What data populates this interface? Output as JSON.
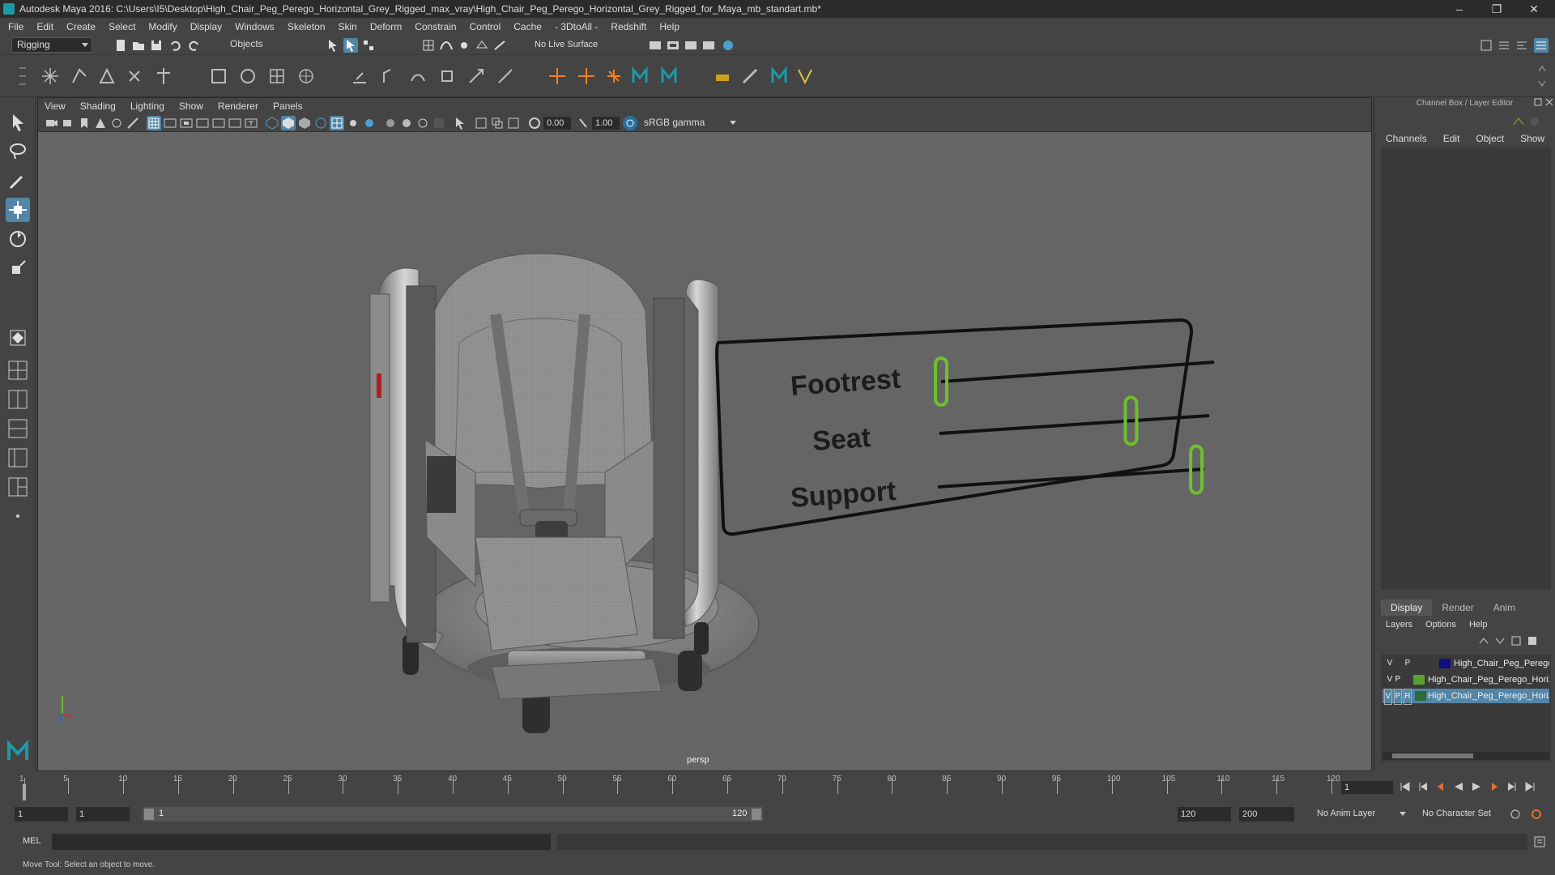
{
  "window": {
    "title": "Autodesk Maya 2016: C:\\Users\\I5\\Desktop\\High_Chair_Peg_Perego_Horizontal_Grey_Rigged_max_vray\\High_Chair_Peg_Perego_Horizontal_Grey_Rigged_for_Maya_mb_standart.mb*",
    "controls": [
      "–",
      "❐",
      "✕"
    ]
  },
  "menubar": [
    "File",
    "Edit",
    "Create",
    "Select",
    "Modify",
    "Display",
    "Windows",
    "Skeleton",
    "Skin",
    "Deform",
    "Constrain",
    "Control",
    "Cache",
    "- 3DtoAll -",
    "Redshift",
    "Help"
  ],
  "statusline": {
    "mode": "Rigging",
    "selection_mode": "Objects",
    "live_surface": "No Live Surface"
  },
  "viewport": {
    "menu": [
      "View",
      "Shading",
      "Lighting",
      "Show",
      "Renderer",
      "Panels"
    ],
    "exposure": "0.00",
    "gamma": "1.00",
    "color_space": "sRGB gamma",
    "camera_label": "persp",
    "rig_panel": {
      "labels": [
        "Footrest",
        "Seat",
        "Support"
      ],
      "slider_values": [
        0.0,
        0.71,
        0.97
      ]
    },
    "accent_color": "#6fbf2e"
  },
  "channel_box": {
    "title": "Channel Box / Layer Editor",
    "menu": [
      "Channels",
      "Edit",
      "Object",
      "Show"
    ],
    "tabs": [
      "Display",
      "Render",
      "Anim"
    ],
    "active_tab": "Display",
    "layer_menu": [
      "Layers",
      "Options",
      "Help"
    ],
    "layers": [
      {
        "v": "V",
        "p": "P",
        "r": "",
        "name": "High_Chair_Peg_Perego_Horizontal_Grey_Rigged",
        "color": "#101080",
        "selected": false
      },
      {
        "v": "V",
        "p": "P",
        "r": "",
        "name": "High_Chair_Peg_Perego_Horizontal_Grey_Controllers",
        "color": "#5aa02c",
        "selected": false
      },
      {
        "v": "V",
        "p": "P",
        "r": "R",
        "name": "High_Chair_Peg_Perego_Horizontal_Grey_Helpers",
        "color": "#2a6b3a",
        "selected": true
      }
    ]
  },
  "timeline": {
    "ticks": [
      1,
      5,
      10,
      15,
      20,
      25,
      30,
      35,
      40,
      45,
      50,
      55,
      60,
      65,
      70,
      75,
      80,
      85,
      90,
      95,
      100,
      105,
      110,
      115,
      120
    ],
    "current_frame": "1"
  },
  "range": {
    "start": "1",
    "playback_start": "1",
    "slider_start": "1",
    "slider_end": "120",
    "playback_end": "120",
    "end": "200",
    "anim_layer": "No Anim Layer",
    "character_set": "No Character Set"
  },
  "command_line": {
    "label": "MEL"
  },
  "help_line": "Move Tool: Select an object to move."
}
